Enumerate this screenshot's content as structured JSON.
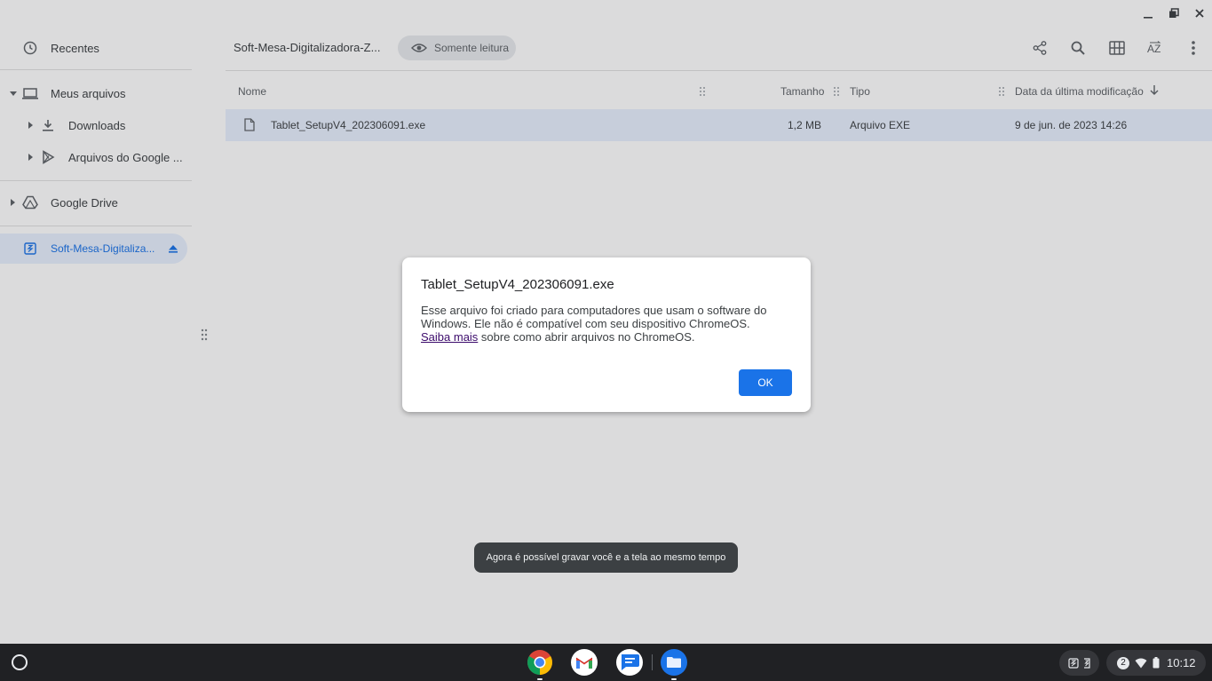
{
  "colors": {
    "accent": "#1a73e8",
    "selection": "#e8f0fe",
    "shelf": "#202124",
    "link": "#3b0a6b"
  },
  "window_controls": {
    "minimize_icon": "minimize-icon",
    "restore_icon": "restore-icon",
    "close_icon": "close-icon"
  },
  "sidebar": {
    "recent": {
      "label": "Recentes",
      "icon": "clock-icon"
    },
    "my_files": {
      "label": "Meus arquivos",
      "icon": "laptop-icon"
    },
    "downloads": {
      "label": "Downloads",
      "icon": "download-icon"
    },
    "play_files": {
      "label": "Arquivos do Google ...",
      "icon": "google-play-icon"
    },
    "drive": {
      "label": "Google Drive",
      "icon": "google-drive-icon"
    },
    "volume": {
      "label": "Soft-Mesa-Digitaliza...",
      "icon": "archive-icon",
      "eject_icon": "eject-icon"
    }
  },
  "toolbar": {
    "breadcrumb": "Soft-Mesa-Digitalizadora-Z...",
    "read_only": "Somente leitura",
    "icons": [
      "share-icon",
      "search-icon",
      "grid-view-icon",
      "sort-az-icon",
      "more-vert-icon"
    ]
  },
  "file_list": {
    "columns": {
      "name": "Nome",
      "size": "Tamanho",
      "type": "Tipo",
      "modified": "Data da última modificação"
    },
    "rows": [
      {
        "name": "Tablet_SetupV4_202306091.exe",
        "size": "1,2 MB",
        "type": "Arquivo EXE",
        "modified": "9 de jun. de 2023 14:26"
      }
    ]
  },
  "dialog": {
    "title": "Tablet_SetupV4_202306091.exe",
    "body_before": "Esse arquivo foi criado para computadores que usam o software do Windows. Ele não é compatível com seu dispositivo ChromeOS. ",
    "link": "Saiba mais",
    "body_after": " sobre como abrir arquivos no ChromeOS.",
    "ok": "OK"
  },
  "toast": {
    "text": "Agora é possível gravar você e a tela ao mesmo tempo"
  },
  "shelf": {
    "apps": [
      "chrome-icon",
      "gmail-icon",
      "messages-icon",
      "files-icon"
    ],
    "notification_count": "2",
    "time": "10:12"
  }
}
